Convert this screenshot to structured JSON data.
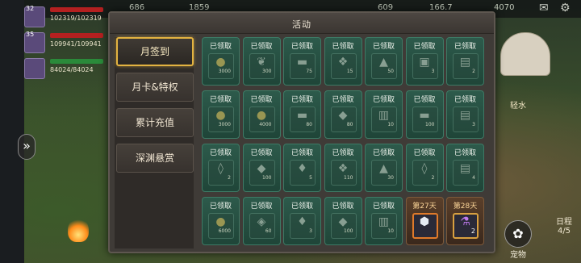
{
  "modal": {
    "title": "活动"
  },
  "tabs": [
    {
      "label": "月签到",
      "active": true
    },
    {
      "label": "月卡&特权",
      "active": false
    },
    {
      "label": "累计充值",
      "active": false
    },
    {
      "label": "深渊悬赏",
      "active": false
    }
  ],
  "grid": {
    "rows": [
      [
        {
          "status": "已领取",
          "icon": "gold-coin-icon",
          "qty": "3000"
        },
        {
          "status": "已领取",
          "icon": "wheat-icon",
          "qty": "300"
        },
        {
          "status": "已领取",
          "icon": "wood-log-icon",
          "qty": "75"
        },
        {
          "status": "已领取",
          "icon": "blue-crystal-icon",
          "qty": "15"
        },
        {
          "status": "已领取",
          "icon": "crystal-dust-icon",
          "qty": "50"
        },
        {
          "status": "已领取",
          "icon": "green-gift-icon",
          "qty": "3"
        },
        {
          "status": "已领取",
          "icon": "scroll-icon",
          "qty": "2"
        }
      ],
      [
        {
          "status": "已领取",
          "icon": "gold-coin-icon",
          "qty": "3000"
        },
        {
          "status": "已领取",
          "icon": "gold-coin-icon",
          "qty": "4000"
        },
        {
          "status": "已领取",
          "icon": "wood-log-icon",
          "qty": "80"
        },
        {
          "status": "已领取",
          "icon": "iron-ingot-icon",
          "qty": "80"
        },
        {
          "status": "已领取",
          "icon": "book-icon",
          "qty": "10"
        },
        {
          "status": "已领取",
          "icon": "wood-log-icon",
          "qty": "100"
        },
        {
          "status": "已领取",
          "icon": "scroll-icon",
          "qty": "3"
        }
      ],
      [
        {
          "status": "已领取",
          "icon": "mystery-shard-icon",
          "qty": "2"
        },
        {
          "status": "已领取",
          "icon": "iron-ingot-icon",
          "qty": "100"
        },
        {
          "status": "已领取",
          "icon": "crystal-shard-icon",
          "qty": "5"
        },
        {
          "status": "已领取",
          "icon": "blue-crystal-icon",
          "qty": "110"
        },
        {
          "status": "已领取",
          "icon": "crystal-dust-icon",
          "qty": "30"
        },
        {
          "status": "已领取",
          "icon": "mystery-shard-icon",
          "qty": "2"
        },
        {
          "status": "已领取",
          "icon": "scroll-icon",
          "qty": "4"
        }
      ],
      [
        {
          "status": "已领取",
          "icon": "gold-coin-icon",
          "qty": "6000"
        },
        {
          "status": "已领取",
          "icon": "diamond-icon",
          "qty": "60"
        },
        {
          "status": "已领取",
          "icon": "crystal-shard-icon",
          "qty": "3"
        },
        {
          "status": "已领取",
          "icon": "iron-ingot-icon",
          "qty": "100"
        },
        {
          "status": "已领取",
          "icon": "book-icon",
          "qty": "10"
        },
        {
          "status": "第27天",
          "icon": "silver-gem-icon",
          "qty": "",
          "pending": true
        },
        {
          "status": "第28天",
          "icon": "purple-potion-icon",
          "qty": "2",
          "pending": true
        }
      ]
    ]
  },
  "hud": {
    "top_resources": [
      "686",
      "1859",
      "609",
      "166.7",
      "4070"
    ],
    "players": [
      {
        "level": "32",
        "hp": "102319/102319"
      },
      {
        "level": "35",
        "hp": "109941/109941"
      },
      {
        "level": "",
        "hp": "84024/84024"
      }
    ],
    "pet_label": "宠物",
    "schedule_label": "日程",
    "schedule_count": "4/5",
    "light_label": "轻水"
  }
}
